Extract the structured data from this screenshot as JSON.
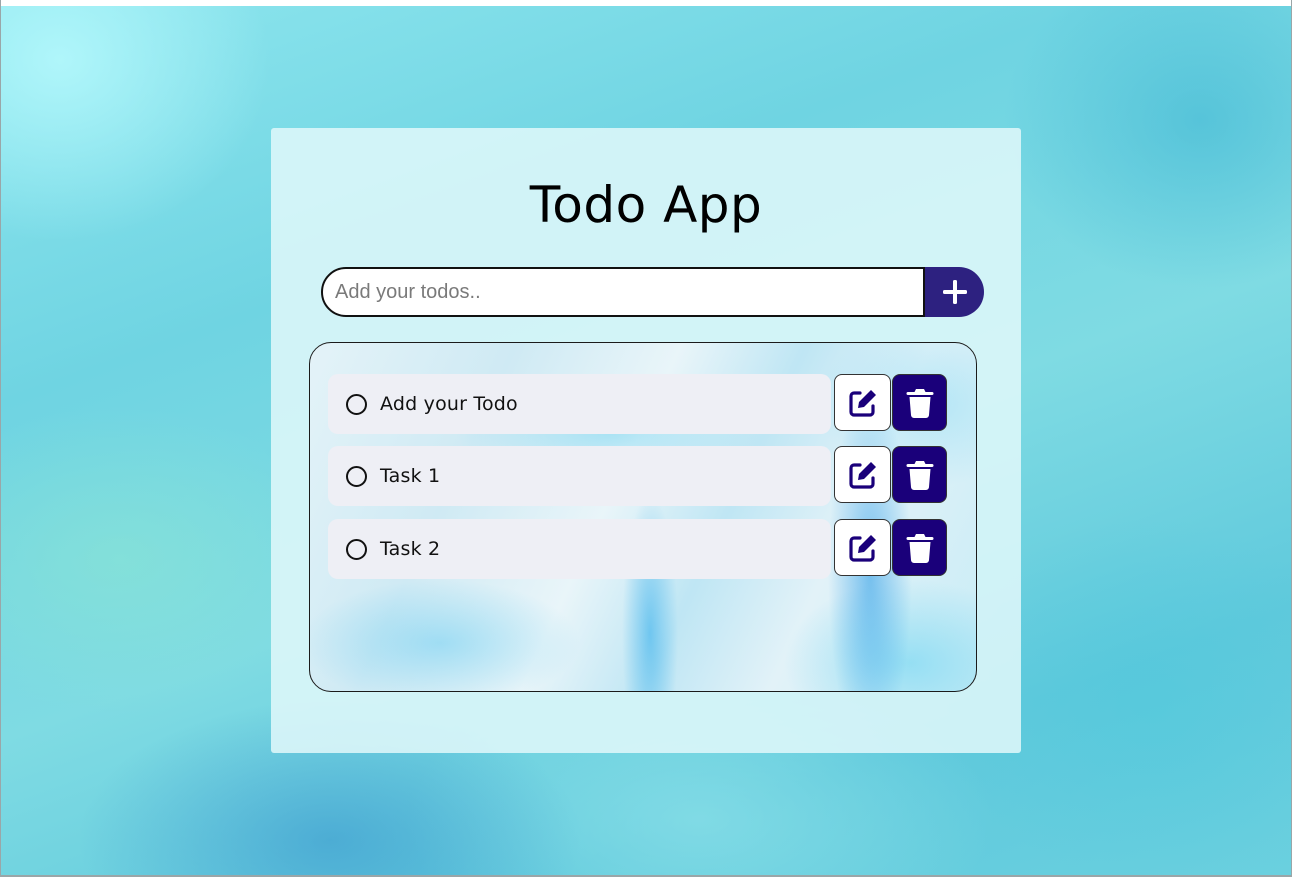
{
  "app": {
    "title": "Todo App"
  },
  "input": {
    "placeholder": "Add your todos..",
    "value": ""
  },
  "add_button": {
    "icon": "plus-icon"
  },
  "todos": [
    {
      "text": "Add your Todo",
      "completed": false,
      "edit_icon": "edit-icon",
      "delete_icon": "trash-icon"
    },
    {
      "text": "Task 1",
      "completed": false,
      "edit_icon": "edit-icon",
      "delete_icon": "trash-icon"
    },
    {
      "text": "Task 2",
      "completed": false,
      "edit_icon": "edit-icon",
      "delete_icon": "trash-icon"
    }
  ],
  "colors": {
    "accent": "#2d2180",
    "delete_button": "#1a007a",
    "edit_icon": "#1a007a",
    "todo_row_background": "#eeeff5",
    "card_background": "#e1f8fa"
  }
}
